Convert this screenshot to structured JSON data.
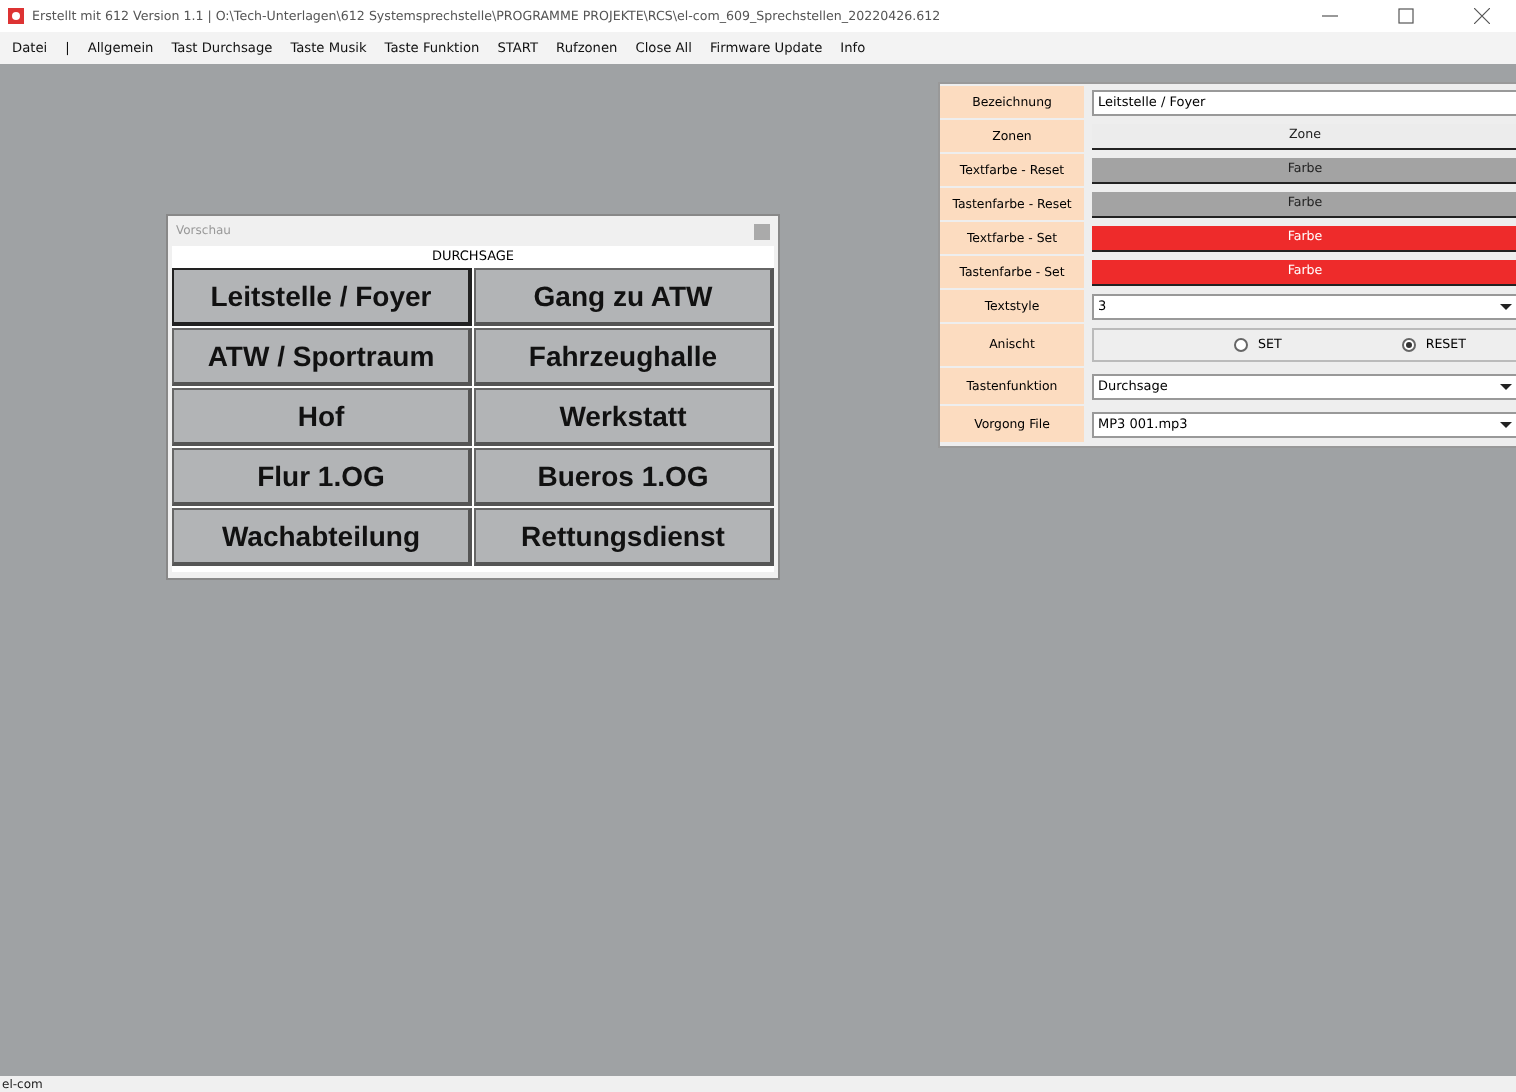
{
  "window": {
    "title": "Erstellt mit 612 Version 1.1 | O:\\Tech-Unterlagen\\612 Systemsprechstelle\\PROGRAMME PROJEKTE\\RCS\\el-com_609_Sprechstellen_20220426.612"
  },
  "menu": [
    "Datei",
    "|",
    "Allgemein",
    "Tast Durchsage",
    "Taste Musik",
    "Taste Funktion",
    "START",
    "Rufzonen",
    "Close All",
    "Firmware Update",
    "Info"
  ],
  "preview": {
    "title": "Vorschau",
    "header": "DURCHSAGE",
    "buttons": [
      {
        "label": "Leitstelle / Foyer",
        "selected": true
      },
      {
        "label": "Gang zu ATW",
        "selected": false
      },
      {
        "label": "ATW / Sportraum",
        "selected": false
      },
      {
        "label": "Fahrzeughalle",
        "selected": false
      },
      {
        "label": "Hof",
        "selected": false
      },
      {
        "label": "Werkstatt",
        "selected": false
      },
      {
        "label": "Flur 1.OG",
        "selected": false
      },
      {
        "label": "Bueros 1.OG",
        "selected": false
      },
      {
        "label": "Wachabteilung",
        "selected": false
      },
      {
        "label": "Rettungsdienst",
        "selected": false
      }
    ]
  },
  "properties": [
    {
      "kind": "text",
      "label": "Bezeichnung",
      "value": "Leitstelle / Foyer"
    },
    {
      "kind": "button",
      "label": "Zonen",
      "button": "Zone"
    },
    {
      "kind": "button",
      "label": "Textfarbe - Reset",
      "button": "Farbe",
      "color": "#a3a3a3"
    },
    {
      "kind": "button",
      "label": "Tastenfarbe - Reset",
      "button": "Farbe",
      "color": "#a3a3a3"
    },
    {
      "kind": "button",
      "label": "Textfarbe - Set",
      "button": "Farbe",
      "color": "#ee2b2b"
    },
    {
      "kind": "button",
      "label": "Tastenfarbe - Set",
      "button": "Farbe",
      "color": "#ee2b2b"
    },
    {
      "kind": "select",
      "label": "Textstyle",
      "value": "3"
    },
    {
      "kind": "radio",
      "label": "Anischt",
      "options": [
        {
          "label": "SET",
          "selected": false
        },
        {
          "label": "RESET",
          "selected": true
        }
      ]
    },
    {
      "kind": "select",
      "label": "Tastenfunktion",
      "value": "Durchsage"
    },
    {
      "kind": "select",
      "label": "Vorgong File",
      "value": "MP3 001.mp3"
    }
  ],
  "status_bar": "el-com"
}
